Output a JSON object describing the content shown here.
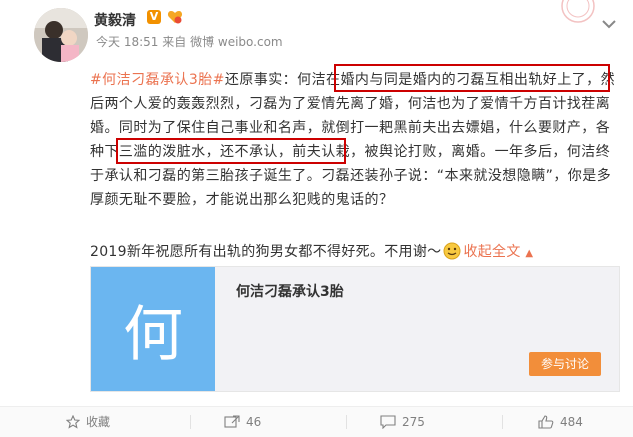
{
  "author": {
    "name": "黄毅清",
    "verified_badge": "V"
  },
  "meta": {
    "time": "今天 18:51",
    "from_label": "来自",
    "source": "微博 weibo.com"
  },
  "post": {
    "tag": "#何洁刁磊承认3胎#",
    "text": "还原事实：何洁在婚内与同是婚内的刁磊互相出轨好上了，然后两个人爱的轰轰烈烈，刁磊为了爱情先离了婚，何洁也为了爱情千方百计找茬离婚。同时为了保住自己事业和名声，就倒打一耙黑前夫出去嫖娼，什么要财产，各种下三滥的泼脏水，还不承认，前夫认栽，被舆论打败，离婚。一年多后，何洁终于承认和刁磊的第三胎孩子诞生了。刁磊还装孙子说：“本来就没想隐瞒”，你是多厚颜无耻不要脸，才能说出那么犯贱的鬼话的？",
    "footer_text": "2019新年祝愿所有出轨的狗男女都不得好死。不用谢～",
    "collapse_label": "收起全文",
    "collapse_arrow": "▲"
  },
  "card": {
    "thumb_char": "何",
    "title": "何洁刁磊承认3胎",
    "button_label": "参与讨论"
  },
  "toolbar": {
    "favorite_label": "收藏",
    "repost_count": "46",
    "comment_count": "275",
    "like_count": "484"
  },
  "colors": {
    "accent": "#eb7350",
    "highlight_box": "#cc0000",
    "card_thumb": "#6bb6f0",
    "card_button": "#f28e3a"
  }
}
